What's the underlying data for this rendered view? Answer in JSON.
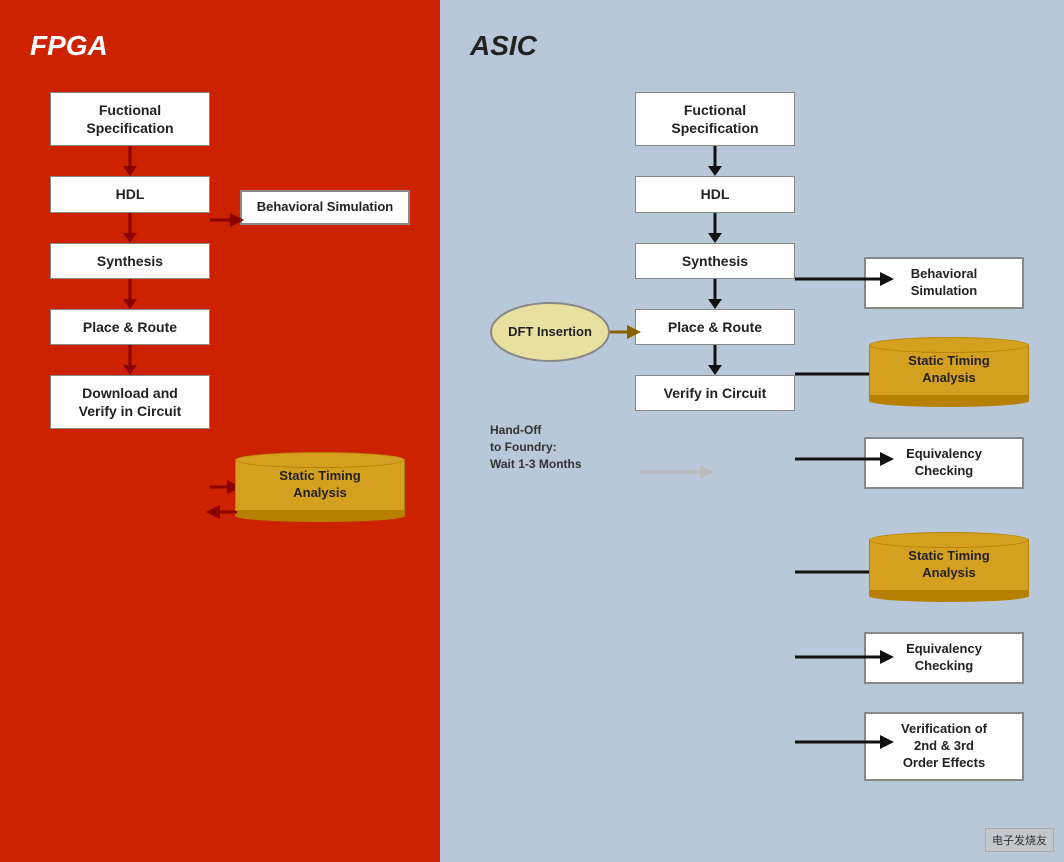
{
  "fpga": {
    "title": "FPGA",
    "flow": [
      {
        "label": "Fuctional\nSpecification"
      },
      {
        "label": "HDL"
      },
      {
        "label": "Synthesis"
      },
      {
        "label": "Place & Route"
      },
      {
        "label": "Download and\nVerify in Circuit"
      }
    ],
    "side_items": {
      "behavioral_sim": {
        "label": "Behavioral\nSimulation"
      },
      "static_timing": {
        "label": "Static Timing\nAnalysis"
      }
    }
  },
  "asic": {
    "title": "ASIC",
    "flow": [
      {
        "label": "Fuctional\nSpecification"
      },
      {
        "label": "HDL"
      },
      {
        "label": "Synthesis"
      },
      {
        "label": "Place & Route"
      },
      {
        "label": "Verify in Circuit"
      }
    ],
    "dft": {
      "label": "DFT\nInsertion"
    },
    "handoff": {
      "label": "Hand-Off\nto Foundry:\nWait 1-3 Months"
    },
    "right_items": {
      "behavioral_sim": {
        "label": "Behavioral\nSimulation"
      },
      "static_timing_1": {
        "label": "Static Timing\nAnalysis"
      },
      "eq_checking_1": {
        "label": "Equivalency\nChecking"
      },
      "static_timing_2": {
        "label": "Static Timing\nAnalysis"
      },
      "eq_checking_2": {
        "label": "Equivalency\nChecking"
      },
      "verification": {
        "label": "Verification of\n2nd & 3rd\nOrder Effects"
      }
    }
  },
  "watermark": "电子发烧友"
}
